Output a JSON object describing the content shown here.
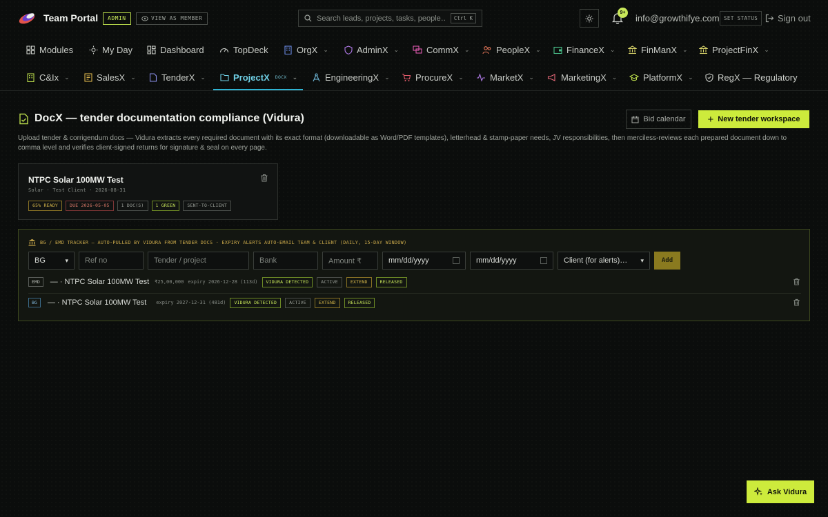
{
  "header": {
    "app_title": "Team Portal",
    "role_badge": "ADMIN",
    "view_as_label": "VIEW AS MEMBER",
    "search_placeholder": "Search leads, projects, tasks, people…",
    "search_shortcut": "Ctrl K",
    "notifications_count": "9+",
    "user_email": "info@growthifye.com",
    "set_status_label": "SET STATUS",
    "signout_label": "Sign out"
  },
  "nav_primary": [
    {
      "label": "Modules",
      "icon": "grid-icon"
    },
    {
      "label": "My Day",
      "icon": "sun-icon"
    },
    {
      "label": "Dashboard",
      "icon": "dashboard-icon"
    },
    {
      "label": "TopDeck",
      "icon": "gauge-icon"
    },
    {
      "label": "OrgX",
      "icon": "building-icon"
    },
    {
      "label": "AdminX",
      "icon": "shield-icon"
    },
    {
      "label": "CommX",
      "icon": "chat-icon"
    },
    {
      "label": "PeopleX",
      "icon": "people-icon"
    },
    {
      "label": "FinanceX",
      "icon": "wallet-icon"
    },
    {
      "label": "FinManX",
      "icon": "bank-icon"
    },
    {
      "label": "ProjectFinX",
      "icon": "bank-icon"
    }
  ],
  "nav_secondary": [
    {
      "label": "C&Ix",
      "icon": "building-icon"
    },
    {
      "label": "SalesX",
      "icon": "doc-icon"
    },
    {
      "label": "TenderX",
      "icon": "file-icon"
    },
    {
      "label": "ProjectX",
      "icon": "folder-icon",
      "sub": "DOCX"
    },
    {
      "label": "EngineeringX",
      "icon": "compass-icon"
    },
    {
      "label": "ProcureX",
      "icon": "cart-icon"
    },
    {
      "label": "MarketX",
      "icon": "pulse-icon"
    },
    {
      "label": "MarketingX",
      "icon": "megaphone-icon"
    },
    {
      "label": "PlatformX",
      "icon": "graduation-icon"
    },
    {
      "label": "RegX — Regulatory",
      "icon": "shield-check-icon"
    }
  ],
  "page": {
    "title": "DocX — tender documentation compliance (Vidura)",
    "bid_calendar_label": "Bid calendar",
    "new_workspace_label": "New tender workspace",
    "description": "Upload tender & corrigendum docs — Vidura extracts every required document with its exact format (downloadable as Word/PDF templates), letterhead & stamp-paper needs, JV responsibilities, then merciless-reviews each prepared document down to comma level and verifies client-signed returns for signature & seal on every page."
  },
  "workspace_card": {
    "title": "NTPC Solar 100MW Test",
    "meta": "Solar · Test Client · 2026-08-31",
    "tags": [
      "65% READY",
      "DUE 2026-05-05",
      "1 DOC(S)",
      "1 GREEN",
      "SENT-TO-CLIENT"
    ]
  },
  "tracker": {
    "heading": "BG / EMD TRACKER — AUTO-PULLED BY VIDURA FROM TENDER DOCS · EXPIRY ALERTS AUTO-EMAIL TEAM & CLIENT (DAILY, 15-DAY WINDOW)",
    "form": {
      "type_value": "BG",
      "ref_placeholder": "Ref no",
      "tender_placeholder": "Tender / project",
      "bank_placeholder": "Bank",
      "amount_placeholder": "Amount ₹",
      "date1_placeholder": "mm/dd/yyyy",
      "date2_placeholder": "mm/dd/yyyy",
      "client_value": "Client (for alerts)…",
      "add_label": "Add"
    },
    "rows": [
      {
        "kind": "EMD",
        "name": "— · NTPC Solar 100MW Test",
        "amount": "₹25,00,000",
        "expiry": "expiry 2026-12-28 (113d)",
        "tags": [
          "VIDURA DETECTED",
          "ACTIVE",
          "EXTEND",
          "RELEASED"
        ]
      },
      {
        "kind": "BG",
        "name": "— · NTPC Solar 100MW Test",
        "amount": "",
        "expiry": "expiry 2027-12-31 (481d)",
        "tags": [
          "VIDURA DETECTED",
          "ACTIVE",
          "EXTEND",
          "RELEASED"
        ]
      }
    ]
  },
  "assistant": {
    "label": "Ask Vidura"
  }
}
